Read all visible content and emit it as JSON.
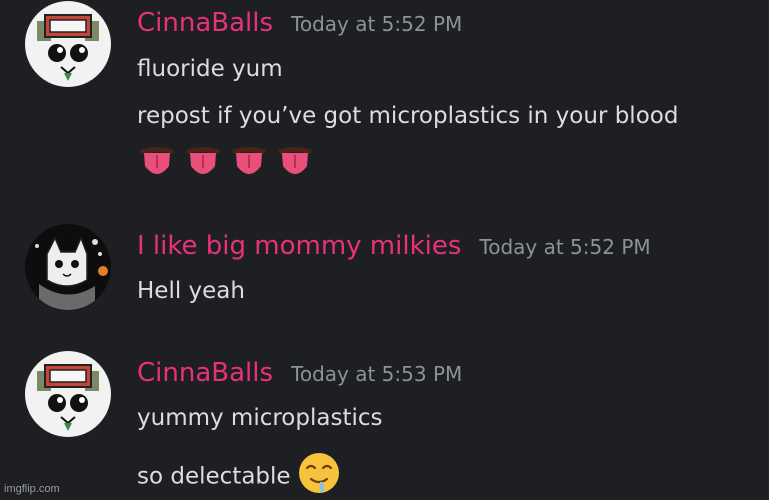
{
  "messages": [
    {
      "username": "CinnaBalls",
      "timestamp": "Today at 5:52 PM",
      "lines": [
        "fluoride yum",
        "repost if you’ve got microplastics in your blood"
      ],
      "emoji": [
        "tongue-emoji",
        "tongue-emoji",
        "tongue-emoji",
        "tongue-emoji"
      ]
    },
    {
      "username": "I like big mommy milkies",
      "timestamp": "Today at 5:52 PM",
      "lines": [
        "Hell yeah"
      ]
    },
    {
      "username": "CinnaBalls",
      "timestamp": "Today at 5:53 PM",
      "lines": [
        "yummy microplastics",
        "so delectable"
      ],
      "emoji": [
        "drooling-face-emoji"
      ]
    }
  ],
  "watermark": "imgflip.com",
  "colors": {
    "background": "#1e1f22",
    "username": "#e8317a",
    "text": "#dcdde1",
    "timestamp": "#8e9198"
  }
}
